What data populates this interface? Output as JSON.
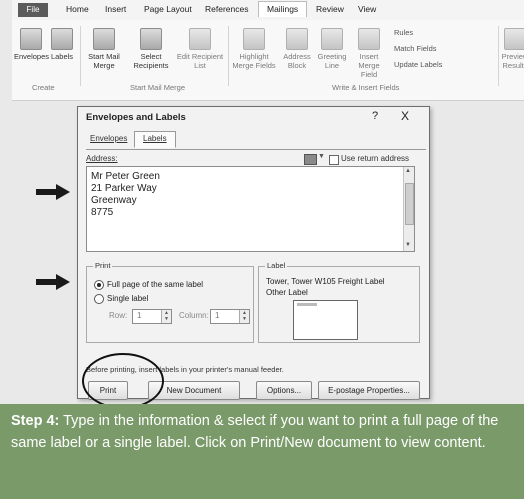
{
  "ribbon": {
    "tabs": [
      "File",
      "Home",
      "Insert",
      "Page Layout",
      "References",
      "Mailings",
      "Review",
      "View"
    ],
    "buttons": {
      "envelopes": "Envelopes",
      "labels": "Labels",
      "start_mail_merge": "Start Mail Merge",
      "select_recipients": "Select Recipients",
      "edit_recipient_list": "Edit Recipient List",
      "highlight_merge_fields": "Highlight Merge Fields",
      "address_block": "Address Block",
      "greeting_line": "Greeting Line",
      "insert_merge_field": "Insert Merge Field",
      "rules": "Rules",
      "match_fields": "Match Fields",
      "update_labels": "Update Labels",
      "preview_results": "Preview Results"
    },
    "groups": {
      "create": "Create",
      "start_mail_merge": "Start Mail Merge",
      "write_insert_fields": "Write & Insert Fields"
    }
  },
  "dialog": {
    "title": "Envelopes and Labels",
    "help": "?",
    "close": "X",
    "tabs": [
      "Envelopes",
      "Labels"
    ],
    "address_label": "Address:",
    "use_return_address": "Use return address",
    "address_lines": [
      "Mr Peter Green",
      "21 Parker Way",
      "Greenway",
      "8775"
    ],
    "print_group": "Print",
    "full_page": "Full page of the same label",
    "single_label": "Single label",
    "row_label": "Row:",
    "row_value": "1",
    "column_label": "Column:",
    "column_value": "1",
    "label_group": "Label",
    "label_line1": "Tower, Tower W105 Freight Label",
    "label_line2": "Other Label",
    "note": "Before printing, insert labels in your printer's manual feeder.",
    "buttons": [
      "Print",
      "New Document",
      "Options...",
      "E-postage Properties..."
    ]
  },
  "caption": {
    "step": "Step 4:",
    "text": "Type in the information & select if you want to print a full page of the same label or a single label. Click on Print/New document to view content."
  },
  "colors": {
    "caption_bg": "#7a9a6a",
    "caption_text": "#ffffff"
  }
}
